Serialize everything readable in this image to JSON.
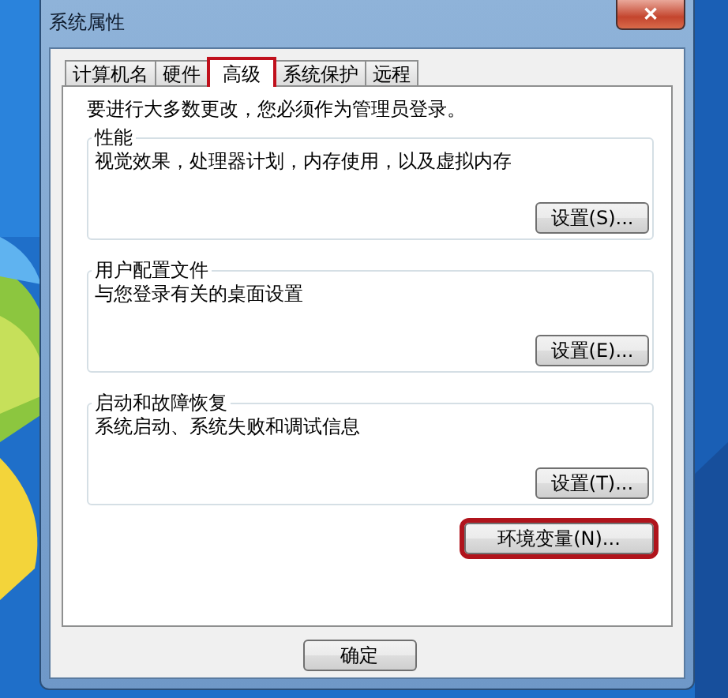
{
  "window": {
    "title": "系统属性",
    "close": "✕"
  },
  "tabs": [
    {
      "label": "计算机名",
      "selected": false,
      "highlighted": false
    },
    {
      "label": "硬件",
      "selected": false,
      "highlighted": false
    },
    {
      "label": "高级",
      "selected": true,
      "highlighted": true
    },
    {
      "label": "系统保护",
      "selected": false,
      "highlighted": false
    },
    {
      "label": "远程",
      "selected": false,
      "highlighted": false
    }
  ],
  "notice": "要进行大多数更改，您必须作为管理员登录。",
  "groups": [
    {
      "title": "性能",
      "description": "视觉效果，处理器计划，内存使用，以及虚拟内存",
      "button": "设置(S)..."
    },
    {
      "title": "用户配置文件",
      "description": "与您登录有关的桌面设置",
      "button": "设置(E)..."
    },
    {
      "title": "启动和故障恢复",
      "description": "系统启动、系统失败和调试信息",
      "button": "设置(T)..."
    }
  ],
  "env_button": {
    "label": "环境变量(N)...",
    "highlighted": true
  },
  "buttons": [
    {
      "label": "确定"
    }
  ]
}
